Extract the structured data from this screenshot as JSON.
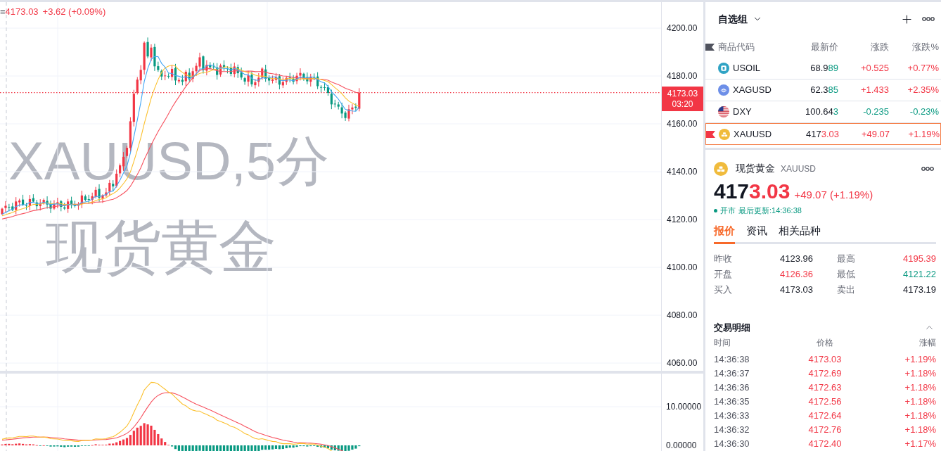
{
  "chart": {
    "legend": {
      "label": "=",
      "close": "4173.03",
      "change": "+3.62 (+0.09%)",
      "up": true
    },
    "symbol_watermark": "XAUUSD,5分",
    "name_watermark": "现货黄金",
    "price_axis": [
      "4200.00",
      "4180.00",
      "4160.00",
      "4140.00",
      "4120.00",
      "4100.00",
      "4080.00",
      "4060.00"
    ],
    "last_price_tag": {
      "price": "4173.03",
      "countdown": "03:20"
    }
  },
  "indicator": {
    "axis": [
      "10.00000",
      "0.00000"
    ]
  },
  "watchlist": {
    "title": "自选组",
    "columns": [
      "商品代码",
      "最新价",
      "涨跌",
      "涨跌%"
    ],
    "rows": [
      {
        "kind": "oil",
        "symbol": "USOIL",
        "price_base": "68.9",
        "price_tail": "89",
        "tail_up": false,
        "change": "+0.525",
        "change_pct": "+0.77%",
        "up": true,
        "selected": false
      },
      {
        "kind": "silver",
        "symbol": "XAGUSD",
        "price_base": "62.3",
        "price_tail": "85",
        "tail_up": false,
        "change": "+1.433",
        "change_pct": "+2.35%",
        "up": true,
        "selected": false
      },
      {
        "kind": "index",
        "symbol": "DXY",
        "price_base": "100.64",
        "price_tail": "3",
        "tail_up": false,
        "change": "-0.235",
        "change_pct": "-0.23%",
        "up": false,
        "selected": false
      },
      {
        "kind": "gold",
        "symbol": "XAUUSD",
        "price_base": "417",
        "price_tail": "3.03",
        "tail_up": true,
        "change": "+49.07",
        "change_pct": "+1.19%",
        "up": true,
        "selected": true
      }
    ]
  },
  "quote": {
    "kind": "gold",
    "name": "现货黄金",
    "symbol": "XAUUSD",
    "price_base": "417",
    "price_tail": "3.03",
    "tail_up": true,
    "change": "+49.07 (+1.19%)",
    "up": true,
    "status": "开市",
    "updated": "最后更新:14:36:38",
    "tabs": [
      {
        "label": "报价",
        "selected": true
      },
      {
        "label": "资讯",
        "selected": false
      },
      {
        "label": "相关品种",
        "selected": false
      }
    ],
    "stats": [
      {
        "label": "昨收",
        "value": "4123.96",
        "color": "#131722"
      },
      {
        "label": "最高",
        "value": "4195.39",
        "color": "#f23645"
      },
      {
        "label": "开盘",
        "value": "4126.36",
        "color": "#f23645"
      },
      {
        "label": "最低",
        "value": "4121.22",
        "color": "#089981"
      },
      {
        "label": "买入",
        "value": "4173.03",
        "color": "#131722"
      },
      {
        "label": "卖出",
        "value": "4173.19",
        "color": "#131722"
      }
    ]
  },
  "trades": {
    "title": "交易明细",
    "expanded": true,
    "columns": [
      "时间",
      "价格",
      "涨幅"
    ],
    "rows": [
      {
        "time": "14:36:38",
        "price": "4173.03",
        "change_pct": "+1.19%",
        "up": true
      },
      {
        "time": "14:36:37",
        "price": "4172.69",
        "change_pct": "+1.18%",
        "up": true
      },
      {
        "time": "14:36:36",
        "price": "4172.63",
        "change_pct": "+1.18%",
        "up": true
      },
      {
        "time": "14:36:35",
        "price": "4172.56",
        "change_pct": "+1.18%",
        "up": true
      },
      {
        "time": "14:36:33",
        "price": "4172.64",
        "change_pct": "+1.18%",
        "up": true
      },
      {
        "time": "14:36:32",
        "price": "4172.76",
        "change_pct": "+1.18%",
        "up": true
      },
      {
        "time": "14:36:30",
        "price": "4172.40",
        "change_pct": "+1.17%",
        "up": true
      }
    ]
  }
}
